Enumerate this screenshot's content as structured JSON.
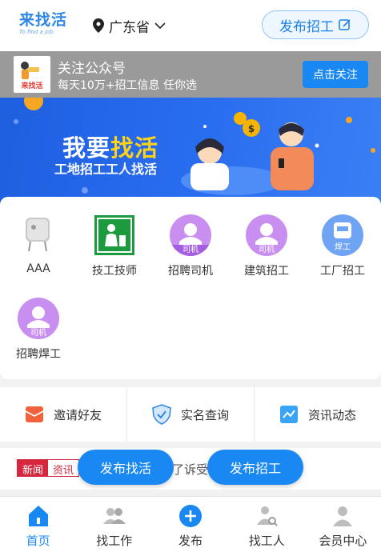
{
  "header": {
    "logo_cn": "来找活",
    "logo_en": "To find a job",
    "region": "广东省",
    "post_job_label": "发布招工"
  },
  "follow_bar": {
    "thumb_text": "来找活",
    "title": "关注公众号",
    "subtitle": "每天10万+招工信息 任你选",
    "button_label": "点击关注"
  },
  "banner": {
    "headline_prefix": "我要",
    "headline_highlight": "找活",
    "subline": "工地招工工人找活"
  },
  "categories": [
    {
      "label": "AAA",
      "icon": "water-heater-icon"
    },
    {
      "label": "技工技师",
      "icon": "technician-icon"
    },
    {
      "label": "招聘司机",
      "icon": "driver-icon",
      "badge": "司机"
    },
    {
      "label": "建筑招工",
      "icon": "driver-icon",
      "badge": "司机"
    },
    {
      "label": "工厂招工",
      "icon": "welder-icon",
      "badge": "焊工"
    },
    {
      "label": "招聘焊工",
      "icon": "driver-icon",
      "badge": "司机"
    }
  ],
  "tools": [
    {
      "label": "邀请好友",
      "icon": "envelope-icon",
      "color": "#f0623b"
    },
    {
      "label": "实名查询",
      "icon": "shield-check-icon",
      "color": "#2d86e8"
    },
    {
      "label": "资讯动态",
      "icon": "trend-chart-icon",
      "color": "#3aa3f5"
    }
  ],
  "news": {
    "tag_a": "新闻",
    "tag_b": "资讯",
    "text": "…了诉受理“…·…狗人”…"
  },
  "floating": {
    "find_work_label": "发布找活",
    "post_job_label": "发布招工"
  },
  "tabbar": [
    {
      "label": "首页",
      "icon": "home-icon",
      "active": true
    },
    {
      "label": "找工作",
      "icon": "people-icon",
      "active": false
    },
    {
      "label": "发布",
      "icon": "plus-circle-icon",
      "active": false
    },
    {
      "label": "找工人",
      "icon": "worker-search-icon",
      "active": false
    },
    {
      "label": "会员中心",
      "icon": "user-icon",
      "active": false
    }
  ],
  "colors": {
    "accent": "#1a88f2",
    "brand_logo": "#2d86e8",
    "news_red": "#d6273f",
    "banner_blue": "#2a6ef0",
    "highlight_yellow": "#ffd21a"
  }
}
